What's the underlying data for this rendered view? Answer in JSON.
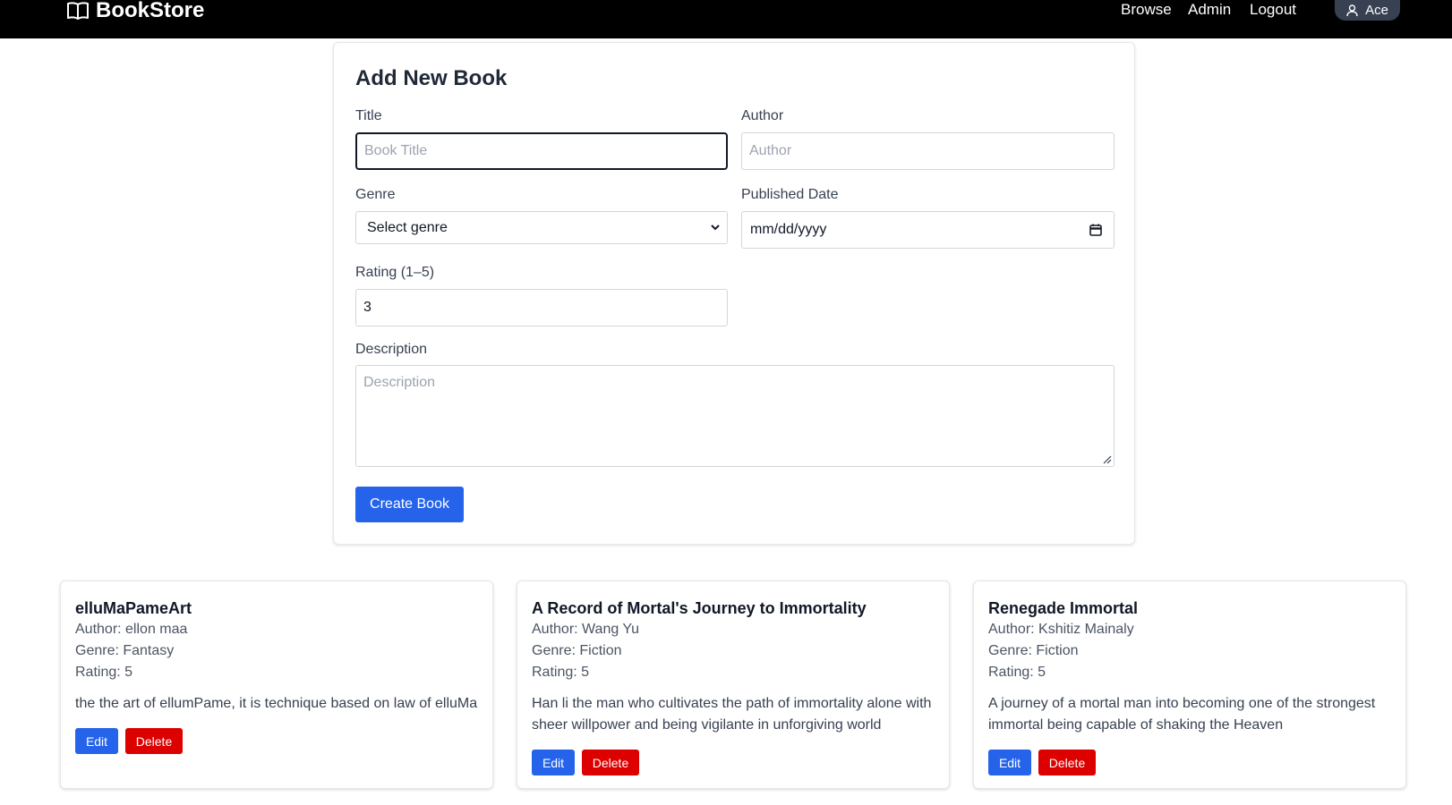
{
  "navbar": {
    "brand": "BookStore",
    "links": [
      "Browse",
      "Admin",
      "Logout"
    ],
    "user": "Ace"
  },
  "form": {
    "title": "Add New Book",
    "title_label": "Title",
    "title_placeholder": "Book Title",
    "author_label": "Author",
    "author_placeholder": "Author",
    "genre_label": "Genre",
    "genre_value": "Select genre",
    "date_label": "Published Date",
    "date_value": "mm/dd/yyyy",
    "rating_label": "Rating (1–5)",
    "rating_value": "3",
    "description_label": "Description",
    "description_placeholder": "Description",
    "submit_label": "Create Book"
  },
  "books": [
    {
      "title": "elluMaPameArt",
      "author": "Author: ellon maa",
      "genre": "Genre: Fantasy",
      "rating": "Rating: 5",
      "description": "the the art of ellumPame, it is technique based on law of elluMa",
      "edit": "Edit",
      "delete": "Delete"
    },
    {
      "title": "A Record of Mortal's Journey to Immortality",
      "author": "Author: Wang Yu",
      "genre": "Genre: Fiction",
      "rating": "Rating: 5",
      "description": "Han li the man who cultivates the path of immortality alone with sheer willpower and being vigilante in unforgiving world",
      "edit": "Edit",
      "delete": "Delete"
    },
    {
      "title": "Renegade Immortal",
      "author": "Author: Kshitiz Mainaly",
      "genre": "Genre: Fiction",
      "rating": "Rating: 5",
      "description": "A journey of a mortal man into becoming one of the strongest immortal being capable of shaking the Heaven",
      "edit": "Edit",
      "delete": "Delete"
    }
  ],
  "colors": {
    "navbar_bg": "#000000",
    "primary": "#2563eb",
    "danger": "#dc0000"
  }
}
